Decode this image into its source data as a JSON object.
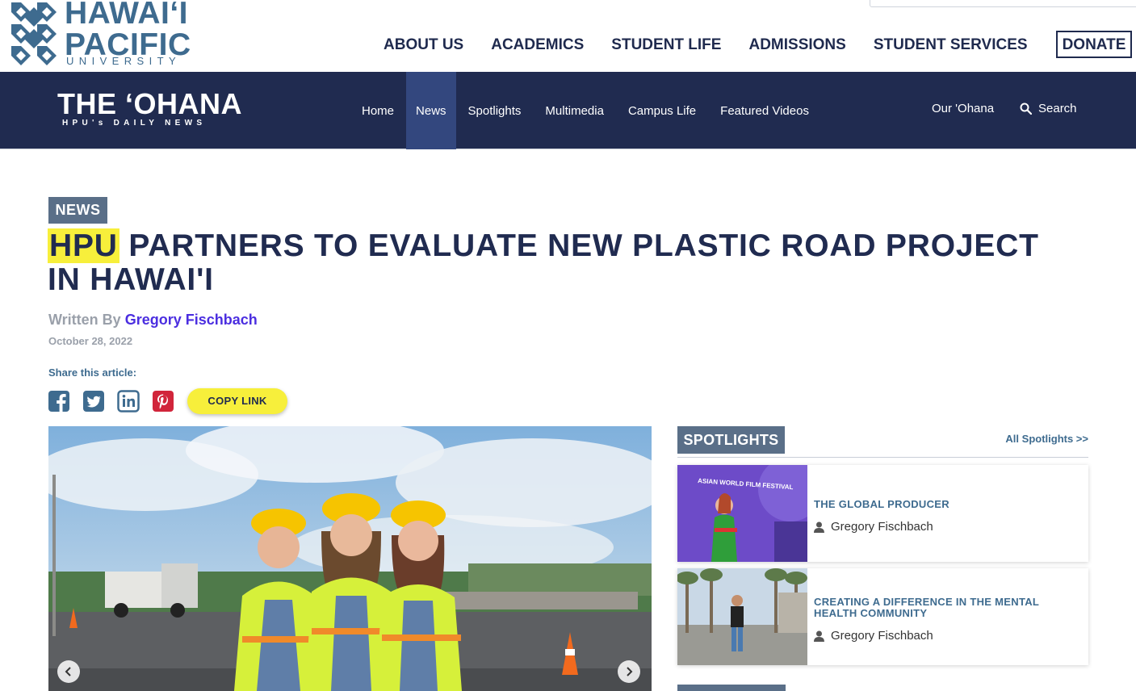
{
  "site": {
    "logo_line1": "HAWAIʻI",
    "logo_line2": "PACIFIC",
    "logo_line3": "UNIVERSITY",
    "main_nav": [
      "ABOUT US",
      "ACADEMICS",
      "STUDENT LIFE",
      "ADMISSIONS",
      "STUDENT SERVICES"
    ],
    "donate_label": "DONATE"
  },
  "ohana": {
    "title": "THE ʻOHANA",
    "subtitle": "HPU's DAILY NEWS",
    "nav": [
      {
        "label": "Home",
        "active": false
      },
      {
        "label": "News",
        "active": true
      },
      {
        "label": "Spotlights",
        "active": false
      },
      {
        "label": "Multimedia",
        "active": false
      },
      {
        "label": "Campus Life",
        "active": false
      },
      {
        "label": "Featured Videos",
        "active": false
      }
    ],
    "our_ohana_label": "Our 'Ohana",
    "search_label": "Search"
  },
  "article": {
    "category": "NEWS",
    "title_highlight": "HPU",
    "title_rest": " PARTNERS TO EVALUATE NEW PLASTIC ROAD PROJECT IN HAWAI'I",
    "written_by_label": "Written By",
    "author": "Gregory Fischbach",
    "date": "October 28, 2022",
    "share_label": "Share this article:",
    "share_icons": [
      "facebook-icon",
      "twitter-icon",
      "linkedin-icon",
      "pinterest-icon"
    ],
    "copy_link_label": "COPY LINK"
  },
  "sidebar": {
    "section_label": "SPOTLIGHTS",
    "all_link": "All Spotlights >>",
    "cards": [
      {
        "title": "THE GLOBAL PRODUCER",
        "author": "Gregory Fischbach",
        "thumb_text": "ASIAN WORLD FILM FESTIVAL"
      },
      {
        "title": "CREATING A DIFFERENCE IN THE MENTAL HEALTH COMMUNITY",
        "author": "Gregory Fischbach"
      }
    ]
  },
  "colors": {
    "navy": "#202b50",
    "accent_blue": "#3e6b8f",
    "tag_gray": "#5a6f88",
    "highlight_yellow": "#f7ef3b",
    "author_purple": "#4b2ee0"
  }
}
